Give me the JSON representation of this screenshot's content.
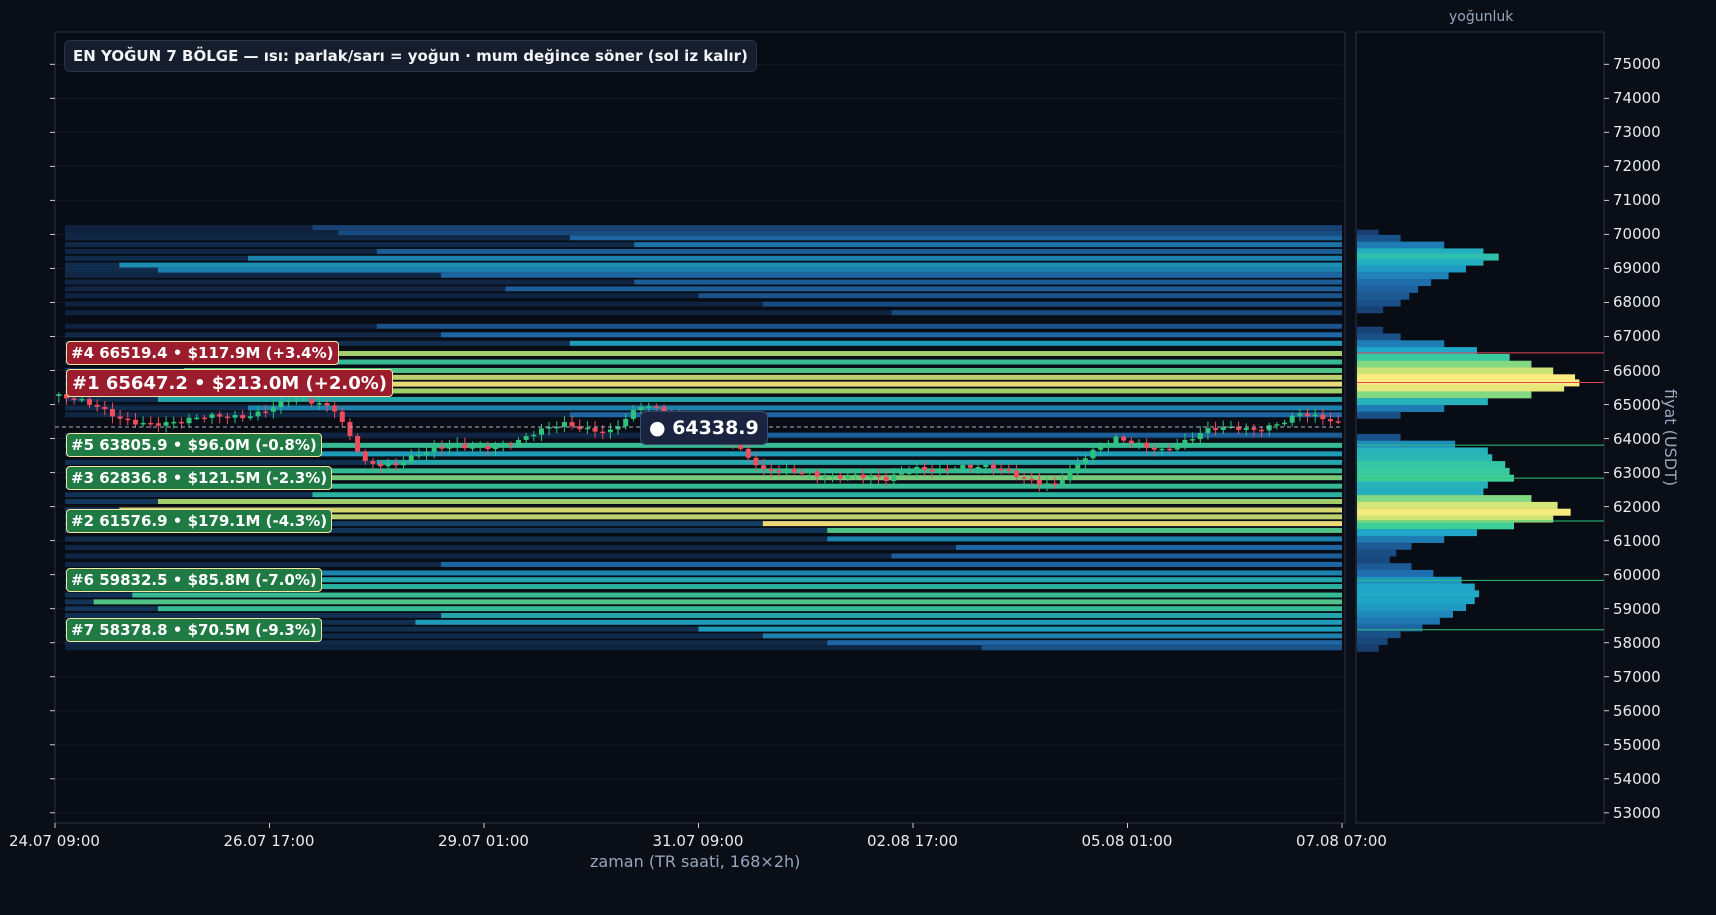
{
  "chart_data": {
    "type": "candlestick",
    "title": "EN YOĞUN 7 BÖLGE — ısı: parlak/sarı = yoğun · mum değince söner (sol iz kalır)",
    "xlabel": "zaman (TR saati, 168×2h)",
    "ylabel": "fiyat (USDT)",
    "profile_title": "yoğunluk",
    "x_ticks": [
      "24.07 09:00",
      "26.07 17:00",
      "29.07 01:00",
      "31.07 09:00",
      "02.08 17:00",
      "05.08 01:00",
      "07.08 07:00"
    ],
    "y_ticks": [
      53000,
      54000,
      55000,
      56000,
      57000,
      58000,
      59000,
      60000,
      61000,
      62000,
      63000,
      64000,
      65000,
      66000,
      67000,
      68000,
      69000,
      70000,
      71000,
      72000,
      73000,
      74000,
      75000
    ],
    "ylim": [
      52700,
      75950
    ],
    "bars": 168,
    "current_price": 64338.9,
    "current_price_label": "● 64338.9",
    "zones": [
      {
        "rank": 4,
        "price": 66519.4,
        "label": "#4  66519.4  •  $117.9M  (+3.4%)",
        "side": "above",
        "color": "#9b1c2c"
      },
      {
        "rank": 1,
        "price": 65647.2,
        "label": "#1  65647.2  •  $213.0M  (+2.0%)",
        "side": "above",
        "color": "#9b1c2c"
      },
      {
        "rank": 5,
        "price": 63805.9,
        "label": "#5  63805.9  •  $96.0M  (-0.8%)",
        "side": "below",
        "color": "#1f7a44"
      },
      {
        "rank": 3,
        "price": 62836.8,
        "label": "#3  62836.8  •  $121.5M  (-2.3%)",
        "side": "below",
        "color": "#1f7a44"
      },
      {
        "rank": 2,
        "price": 61576.9,
        "label": "#2  61576.9  •  $179.1M  (-4.3%)",
        "side": "below",
        "color": "#1f7a44"
      },
      {
        "rank": 6,
        "price": 59832.5,
        "label": "#6  59832.5  •  $85.8M  (-7.0%)",
        "side": "below",
        "color": "#1f7a44"
      },
      {
        "rank": 7,
        "price": 58378.8,
        "label": "#7  58378.8  •  $70.5M  (-9.3%)",
        "side": "below",
        "color": "#1f7a44"
      }
    ],
    "price_path": [
      [
        0,
        65250
      ],
      [
        8,
        64600
      ],
      [
        16,
        64450
      ],
      [
        24,
        64700
      ],
      [
        30,
        65150
      ],
      [
        36,
        64800
      ],
      [
        40,
        63400
      ],
      [
        44,
        63250
      ],
      [
        52,
        63800
      ],
      [
        60,
        63900
      ],
      [
        66,
        64400
      ],
      [
        72,
        64300
      ],
      [
        76,
        64900
      ],
      [
        82,
        64550
      ],
      [
        86,
        64100
      ],
      [
        88,
        63900
      ],
      [
        90,
        63400
      ],
      [
        92,
        62950
      ],
      [
        98,
        63050
      ],
      [
        104,
        62900
      ],
      [
        108,
        62700
      ],
      [
        112,
        63150
      ],
      [
        118,
        63200
      ],
      [
        122,
        63050
      ],
      [
        126,
        62800
      ],
      [
        130,
        62750
      ],
      [
        134,
        63450
      ],
      [
        138,
        63900
      ],
      [
        144,
        63750
      ],
      [
        150,
        64200
      ],
      [
        156,
        64250
      ],
      [
        162,
        64800
      ],
      [
        167,
        64340
      ]
    ],
    "heat_bands": [
      {
        "p": 70200,
        "start": 0.2,
        "i": 0.15
      },
      {
        "p": 70050,
        "start": 0.22,
        "i": 0.2
      },
      {
        "p": 69900,
        "start": 0.4,
        "i": 0.35
      },
      {
        "p": 69700,
        "start": 0.45,
        "i": 0.4
      },
      {
        "p": 69500,
        "start": 0.25,
        "i": 0.3
      },
      {
        "p": 69300,
        "start": 0.15,
        "i": 0.45
      },
      {
        "p": 69100,
        "start": 0.05,
        "i": 0.5
      },
      {
        "p": 68950,
        "start": 0.08,
        "i": 0.45
      },
      {
        "p": 68800,
        "start": 0.3,
        "i": 0.35
      },
      {
        "p": 68600,
        "start": 0.45,
        "i": 0.3
      },
      {
        "p": 68400,
        "start": 0.35,
        "i": 0.3
      },
      {
        "p": 68200,
        "start": 0.5,
        "i": 0.25
      },
      {
        "p": 67950,
        "start": 0.55,
        "i": 0.2
      },
      {
        "p": 67700,
        "start": 0.65,
        "i": 0.2
      },
      {
        "p": 67300,
        "start": 0.25,
        "i": 0.25
      },
      {
        "p": 67050,
        "start": 0.3,
        "i": 0.35
      },
      {
        "p": 66800,
        "start": 0.4,
        "i": 0.55
      },
      {
        "p": 66500,
        "start": 0.05,
        "i": 0.85
      },
      {
        "p": 66250,
        "start": 0.2,
        "i": 0.7
      },
      {
        "p": 66000,
        "start": 0.1,
        "i": 0.75
      },
      {
        "p": 65800,
        "start": 0.05,
        "i": 0.9
      },
      {
        "p": 65600,
        "start": 0.02,
        "i": 1.0
      },
      {
        "p": 65400,
        "start": 0.04,
        "i": 0.85
      },
      {
        "p": 65150,
        "start": 0.08,
        "i": 0.6
      },
      {
        "p": 64900,
        "start": 0.15,
        "i": 0.45
      },
      {
        "p": 64700,
        "start": 0.4,
        "i": 0.35
      },
      {
        "p": 64100,
        "start": 0.5,
        "i": 0.3
      },
      {
        "p": 63800,
        "start": 0.1,
        "i": 0.7
      },
      {
        "p": 63550,
        "start": 0.2,
        "i": 0.55
      },
      {
        "p": 63300,
        "start": 0.25,
        "i": 0.6
      },
      {
        "p": 63050,
        "start": 0.15,
        "i": 0.7
      },
      {
        "p": 62850,
        "start": 0.05,
        "i": 0.8
      },
      {
        "p": 62600,
        "start": 0.1,
        "i": 0.7
      },
      {
        "p": 62350,
        "start": 0.2,
        "i": 0.65
      },
      {
        "p": 62150,
        "start": 0.08,
        "i": 0.85
      },
      {
        "p": 61900,
        "start": 0.05,
        "i": 0.95
      },
      {
        "p": 61700,
        "start": 0.1,
        "i": 0.9
      },
      {
        "p": 61500,
        "start": 0.55,
        "i": 1.0
      },
      {
        "p": 61300,
        "start": 0.6,
        "i": 0.75
      },
      {
        "p": 61050,
        "start": 0.6,
        "i": 0.45
      },
      {
        "p": 60800,
        "start": 0.7,
        "i": 0.35
      },
      {
        "p": 60550,
        "start": 0.65,
        "i": 0.3
      },
      {
        "p": 60300,
        "start": 0.3,
        "i": 0.35
      },
      {
        "p": 60050,
        "start": 0.2,
        "i": 0.45
      },
      {
        "p": 59850,
        "start": 0.05,
        "i": 0.6
      },
      {
        "p": 59650,
        "start": 0.1,
        "i": 0.65
      },
      {
        "p": 59400,
        "start": 0.06,
        "i": 0.7
      },
      {
        "p": 59200,
        "start": 0.03,
        "i": 0.75
      },
      {
        "p": 59000,
        "start": 0.08,
        "i": 0.7
      },
      {
        "p": 58800,
        "start": 0.3,
        "i": 0.6
      },
      {
        "p": 58600,
        "start": 0.28,
        "i": 0.55
      },
      {
        "p": 58400,
        "start": 0.5,
        "i": 0.55
      },
      {
        "p": 58200,
        "start": 0.55,
        "i": 0.45
      },
      {
        "p": 58000,
        "start": 0.6,
        "i": 0.35
      },
      {
        "p": 57850,
        "start": 0.72,
        "i": 0.25
      }
    ],
    "profile": [
      [
        70050,
        0.1
      ],
      [
        69900,
        0.2
      ],
      [
        69700,
        0.4
      ],
      [
        69500,
        0.58
      ],
      [
        69350,
        0.65
      ],
      [
        69200,
        0.58
      ],
      [
        69000,
        0.5
      ],
      [
        68800,
        0.42
      ],
      [
        68600,
        0.34
      ],
      [
        68400,
        0.28
      ],
      [
        68200,
        0.24
      ],
      [
        68000,
        0.2
      ],
      [
        67800,
        0.12
      ],
      [
        67200,
        0.12
      ],
      [
        67000,
        0.2
      ],
      [
        66800,
        0.4
      ],
      [
        66600,
        0.55
      ],
      [
        66400,
        0.7
      ],
      [
        66200,
        0.8
      ],
      [
        66000,
        0.9
      ],
      [
        65800,
        1.0
      ],
      [
        65650,
        1.02
      ],
      [
        65500,
        0.95
      ],
      [
        65300,
        0.8
      ],
      [
        65100,
        0.6
      ],
      [
        64900,
        0.4
      ],
      [
        64700,
        0.2
      ],
      [
        64050,
        0.2
      ],
      [
        63850,
        0.45
      ],
      [
        63650,
        0.6
      ],
      [
        63450,
        0.62
      ],
      [
        63250,
        0.68
      ],
      [
        63050,
        0.7
      ],
      [
        62850,
        0.72
      ],
      [
        62650,
        0.6
      ],
      [
        62450,
        0.58
      ],
      [
        62250,
        0.8
      ],
      [
        62050,
        0.92
      ],
      [
        61850,
        0.98
      ],
      [
        61650,
        0.9
      ],
      [
        61450,
        0.72
      ],
      [
        61250,
        0.55
      ],
      [
        61050,
        0.4
      ],
      [
        60850,
        0.25
      ],
      [
        60650,
        0.18
      ],
      [
        60450,
        0.15
      ],
      [
        60250,
        0.25
      ],
      [
        60050,
        0.35
      ],
      [
        59850,
        0.48
      ],
      [
        59650,
        0.54
      ],
      [
        59450,
        0.56
      ],
      [
        59250,
        0.54
      ],
      [
        59050,
        0.5
      ],
      [
        58850,
        0.44
      ],
      [
        58650,
        0.38
      ],
      [
        58450,
        0.3
      ],
      [
        58250,
        0.2
      ],
      [
        58050,
        0.14
      ],
      [
        57850,
        0.1
      ]
    ]
  },
  "colors": {
    "background": "#0a0e16",
    "plot_bg": "#080c15",
    "bull": "#2fc27a",
    "bear": "#ef4d5e",
    "heat_low": "#142a55",
    "heat_mid": "#1f8fc8",
    "heat_high": "#ffec80"
  }
}
